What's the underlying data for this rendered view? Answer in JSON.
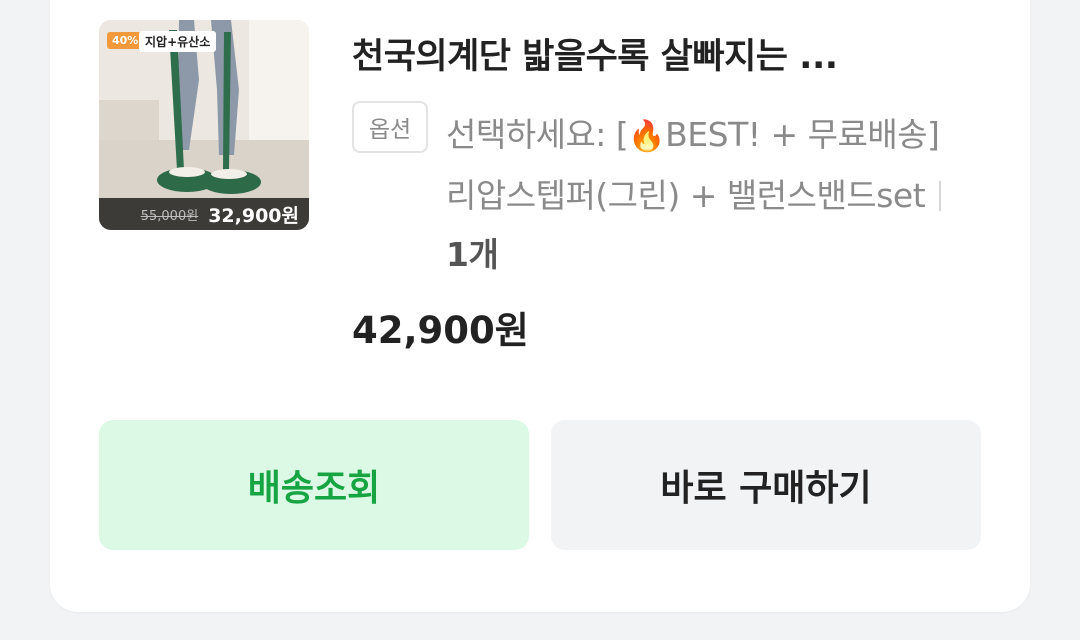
{
  "product": {
    "title": "천국의계단 밟을수록 살빠지는 ...",
    "thumbnail": {
      "discount_badge": "40%",
      "tag_badge": "지압+유산소",
      "original_price": "55,000원",
      "sale_price": "32,900원"
    },
    "option_label": "옵션",
    "option_prefix": "선택하세요: [",
    "option_icon": "🔥",
    "option_value": "BEST! + 무료배송] 리압스텝퍼(그린) + 밸런스밴드set",
    "quantity": "1개",
    "total_price": "42,900원"
  },
  "actions": {
    "track_delivery": "배송조회",
    "buy_now": "바로 구매하기"
  },
  "colors": {
    "accent_green": "#17a544",
    "green_bg": "#dcf9e5",
    "neutral_btn_bg": "#f2f3f5"
  }
}
